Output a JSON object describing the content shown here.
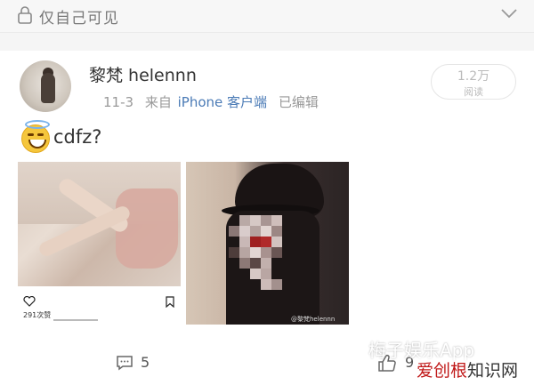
{
  "topbar": {
    "visibility": "仅自己可见",
    "lock_icon": "lock-icon",
    "chevron_icon": "chevron-down-icon"
  },
  "post": {
    "username": "黎梵 helennn",
    "date": "11-3",
    "source_prefix": "来自",
    "device": "iPhone 客户端",
    "edited": "已编辑",
    "reads_count": "1.2万",
    "reads_label": "阅读",
    "text": "cdfz?",
    "emoji": "smile-halo-emoji"
  },
  "images": [
    {
      "name": "post-image-1",
      "likes_text": "291次赞"
    },
    {
      "name": "post-image-2",
      "watermark": "@黎梵helennn"
    }
  ],
  "actions": {
    "comments": "5",
    "likes": "9"
  },
  "watermarks": {
    "top": "梅子娱乐App",
    "bottom_red": "爱创根",
    "bottom_dark": "知识网"
  },
  "colors": {
    "link_blue": "#4b7bb6",
    "meta_gray": "#999999",
    "watermark_red": "#c01818"
  }
}
